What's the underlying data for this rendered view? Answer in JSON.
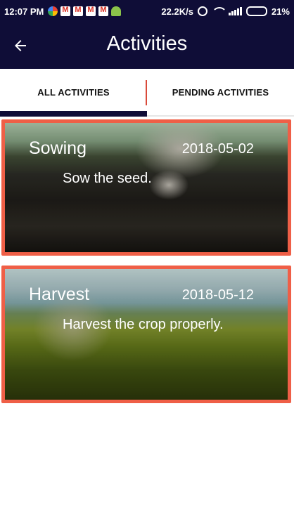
{
  "status_bar": {
    "time": "12:07 PM",
    "network_speed": "22.2K/s",
    "battery_percent": "21%",
    "battery_level": 0.21,
    "notification_icons": [
      "photos-icon",
      "gmail-icon",
      "gmail-icon",
      "gmail-icon",
      "gmail-icon",
      "android-icon"
    ]
  },
  "app_bar": {
    "title": "Activities",
    "back_icon": "arrow-left-icon"
  },
  "tabs": [
    {
      "label": "ALL ACTIVITIES",
      "active": true
    },
    {
      "label": "PENDING ACTIVITIES",
      "active": false
    }
  ],
  "activities": [
    {
      "title": "Sowing",
      "date": "2018-05-02",
      "description": "Sow the seed."
    },
    {
      "title": "Harvest",
      "date": "2018-05-12",
      "description": "Harvest the crop properly."
    }
  ],
  "colors": {
    "primary": "#0f0d37",
    "card_border": "#ef5f47",
    "tab_divider": "#d94a3a"
  }
}
